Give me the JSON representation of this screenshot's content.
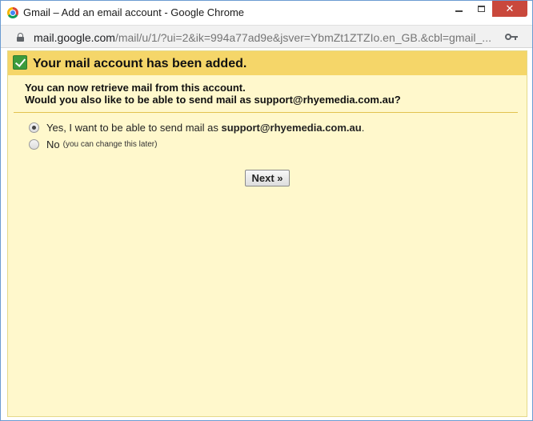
{
  "window": {
    "title": "Gmail – Add an email account - Google Chrome",
    "controls": {
      "minimize": "",
      "maximize": "",
      "close": "✕"
    }
  },
  "address_bar": {
    "domain": "mail.google.com",
    "path": "/mail/u/1/?ui=2&ik=994a77ad9e&jsver=YbmZt1ZTZIo.en_GB.&cbl=gmail_..."
  },
  "banner": {
    "title": "Your mail account has been added."
  },
  "intro": {
    "line1": "You can now retrieve mail from this account.",
    "line2": "Would you also like to be able to send mail as support@rhyemedia.com.au?"
  },
  "options": [
    {
      "label": "Yes, I want to be able to send mail as ",
      "email": "support@rhyemedia.com.au",
      "suffix": ".",
      "selected": true
    },
    {
      "label": "No",
      "hint": "(you can change this later)",
      "selected": false
    }
  ],
  "actions": {
    "next_label": "Next »"
  },
  "colors": {
    "banner": "#f5d669",
    "content_background": "#fff8cc",
    "check": "#3c9b3c",
    "close_button": "#c9483c"
  }
}
